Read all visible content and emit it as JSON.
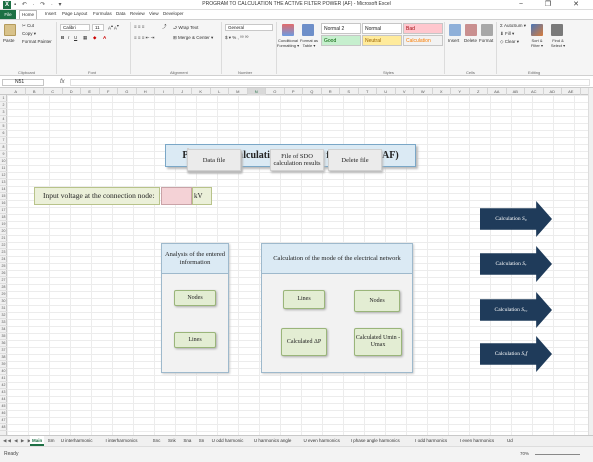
{
  "window": {
    "title": "PROGRAM TO CALCULATION THE ACTIVE FILTER POWER (AF) - Microsoft Excel",
    "app_icon": "X",
    "qat": "▪ ↶ · ↷ · ▾",
    "controls": "− ❐ ✕"
  },
  "ribbon_tabs": [
    "File",
    "Home",
    "Insert",
    "Page Layout",
    "Formulas",
    "Data",
    "Review",
    "View",
    "Developer"
  ],
  "ribbon": {
    "clipboard": {
      "cut": "Cut",
      "copy": "Copy ▾",
      "paste": "Paste",
      "format_painter": "Format Painter",
      "label": "Clipboard"
    },
    "font": {
      "name": "Calibri",
      "size": "11",
      "label": "Font"
    },
    "alignment": {
      "wrap": "Wrap Text",
      "merge": "Merge & Center ▾",
      "label": "Alignment"
    },
    "number": {
      "format": "General",
      "label": "Number"
    },
    "styles": {
      "conditional": "Conditional Formatting ▾",
      "format_table": "Format as Table ▾",
      "boxes": [
        {
          "label": "Normal 2",
          "bg": "#ffffff",
          "fg": "#222222"
        },
        {
          "label": "Normal",
          "bg": "#ffffff",
          "fg": "#222222"
        },
        {
          "label": "Bad",
          "bg": "#ffc7ce",
          "fg": "#9c0006"
        },
        {
          "label": "Good",
          "bg": "#c6efce",
          "fg": "#006100"
        },
        {
          "label": "Neutral",
          "bg": "#ffeb9c",
          "fg": "#9c6500"
        },
        {
          "label": "Calculation",
          "bg": "#f2f2f2",
          "fg": "#fa7d00"
        }
      ],
      "label": "Styles"
    },
    "cells": {
      "insert": "Insert",
      "delete": "Delete",
      "format": "Format",
      "label": "Cells"
    },
    "editing": {
      "autosum": "AutoSum ▾",
      "fill": "Fill ▾",
      "clear": "Clear ▾",
      "sort": "Sort & Filter ▾",
      "find": "Find & Select ▾",
      "label": "Editing"
    }
  },
  "formula_bar": {
    "name_box": "N51",
    "fx": "fx",
    "formula": ""
  },
  "columns": [
    "A",
    "B",
    "C",
    "D",
    "E",
    "F",
    "G",
    "H",
    "I",
    "J",
    "K",
    "L",
    "M",
    "N",
    "O",
    "P",
    "Q",
    "R",
    "S",
    "T",
    "U",
    "V",
    "W",
    "X",
    "Y",
    "Z",
    "AA",
    "AB",
    "AC",
    "AD",
    "AE"
  ],
  "selected_column": "N",
  "rows": [
    "1",
    "2",
    "3",
    "4",
    "5",
    "6",
    "7",
    "8",
    "9",
    "10",
    "11",
    "12",
    "13",
    "14",
    "15",
    "16",
    "17",
    "18",
    "19",
    "20",
    "21",
    "22",
    "23",
    "24",
    "25",
    "26",
    "27",
    "28",
    "29",
    "30",
    "31",
    "32",
    "33",
    "34",
    "35",
    "36",
    "37",
    "38",
    "39",
    "40",
    "41",
    "42",
    "43",
    "44",
    "45",
    "46",
    "47",
    "48"
  ],
  "sheet": {
    "title": "Program to calculation the active filter power (AF)",
    "buttons": {
      "data_file": "Data file",
      "sdo_results": "File of SDO calculation results",
      "delete_file": "Delete file"
    },
    "input_label": "Input voltage at the connection node:",
    "input_value": "",
    "input_unit": "kV",
    "analysis_panel": {
      "title": "Analysis of the entered information",
      "nodes": "Nodes",
      "lines": "Lines"
    },
    "mode_panel": {
      "title": "Calculation of the mode of the electrical network",
      "lines": "Lines",
      "nodes": "Nodes",
      "calc_dp": "Calculated ΔP",
      "calc_u": "Calculated Umin - Umax"
    },
    "arrows": [
      {
        "text": "Calculation ",
        "sym": "S₀"
      },
      {
        "text": "Calculation ",
        "sym": "Sᵥ"
      },
      {
        "text": "Calculation ",
        "sym": "Sᵥ꜀"
      },
      {
        "text": "Calculation ",
        "sym": "Sₐf"
      }
    ]
  },
  "sheet_tabs": [
    "Main",
    "Sm",
    "U interharmonic",
    "I interharmonics",
    "Snc",
    "Snk",
    "Sna",
    "Sn",
    "U odd harmonic",
    "U harmonics angle",
    "U even harmonics",
    "I phase angle harmonics",
    "I odd harmonics",
    "I even harmonics",
    "Ud"
  ],
  "active_tab": "Main",
  "status": {
    "ready": "Ready",
    "zoom": "70%"
  }
}
